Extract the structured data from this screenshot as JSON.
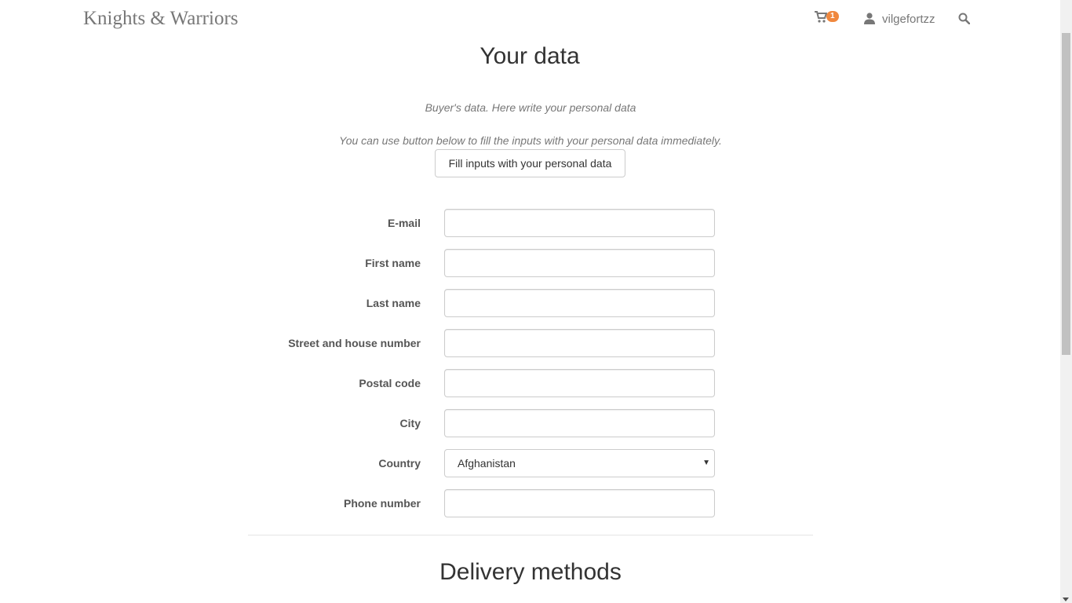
{
  "header": {
    "brand": "Knights & Warriors",
    "cart_count": "1",
    "username": "vilgefortzz",
    "icons": [
      "cart-icon",
      "user-icon",
      "search-icon"
    ]
  },
  "page": {
    "title": "Your data",
    "note1": "Buyer's data. Here write your personal data",
    "note2": "You can use button below to fill the inputs with your personal data immediately.",
    "fill_button": "Fill inputs with your personal data"
  },
  "form": {
    "fields": [
      {
        "label": "E-mail",
        "value": ""
      },
      {
        "label": "First name",
        "value": ""
      },
      {
        "label": "Last name",
        "value": ""
      },
      {
        "label": "Street and house number",
        "value": ""
      },
      {
        "label": "Postal code",
        "value": ""
      },
      {
        "label": "City",
        "value": ""
      },
      {
        "label": "Country",
        "value": "Afghanistan"
      },
      {
        "label": "Phone number",
        "value": ""
      }
    ]
  },
  "delivery": {
    "title": "Delivery methods"
  },
  "colors": {
    "badge": "#f0883e",
    "label": "#555555",
    "muted": "#777777"
  }
}
